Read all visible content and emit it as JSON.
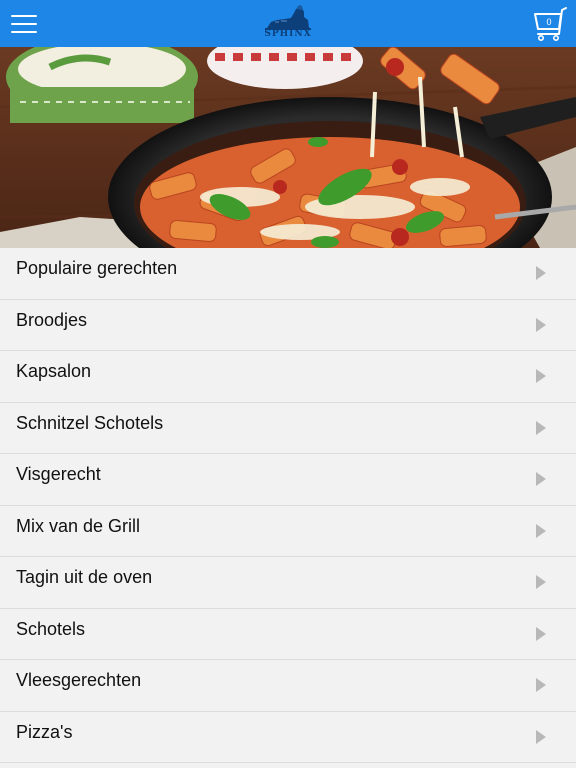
{
  "header": {
    "menu_icon": "hamburger-menu-icon",
    "logo_text": "SPHINX",
    "cart_icon": "shopping-cart-icon",
    "cart_count": "0",
    "background_color": "#1d86e6"
  },
  "hero": {
    "description_icon": "food-photo"
  },
  "categories": [
    {
      "label": "Populaire gerechten"
    },
    {
      "label": "Broodjes"
    },
    {
      "label": "Kapsalon"
    },
    {
      "label": "Schnitzel Schotels"
    },
    {
      "label": "Visgerecht"
    },
    {
      "label": "Mix van de Grill"
    },
    {
      "label": "Tagin uit de oven"
    },
    {
      "label": "Schotels"
    },
    {
      "label": "Vleesgerechten"
    },
    {
      "label": "Pizza's"
    }
  ]
}
